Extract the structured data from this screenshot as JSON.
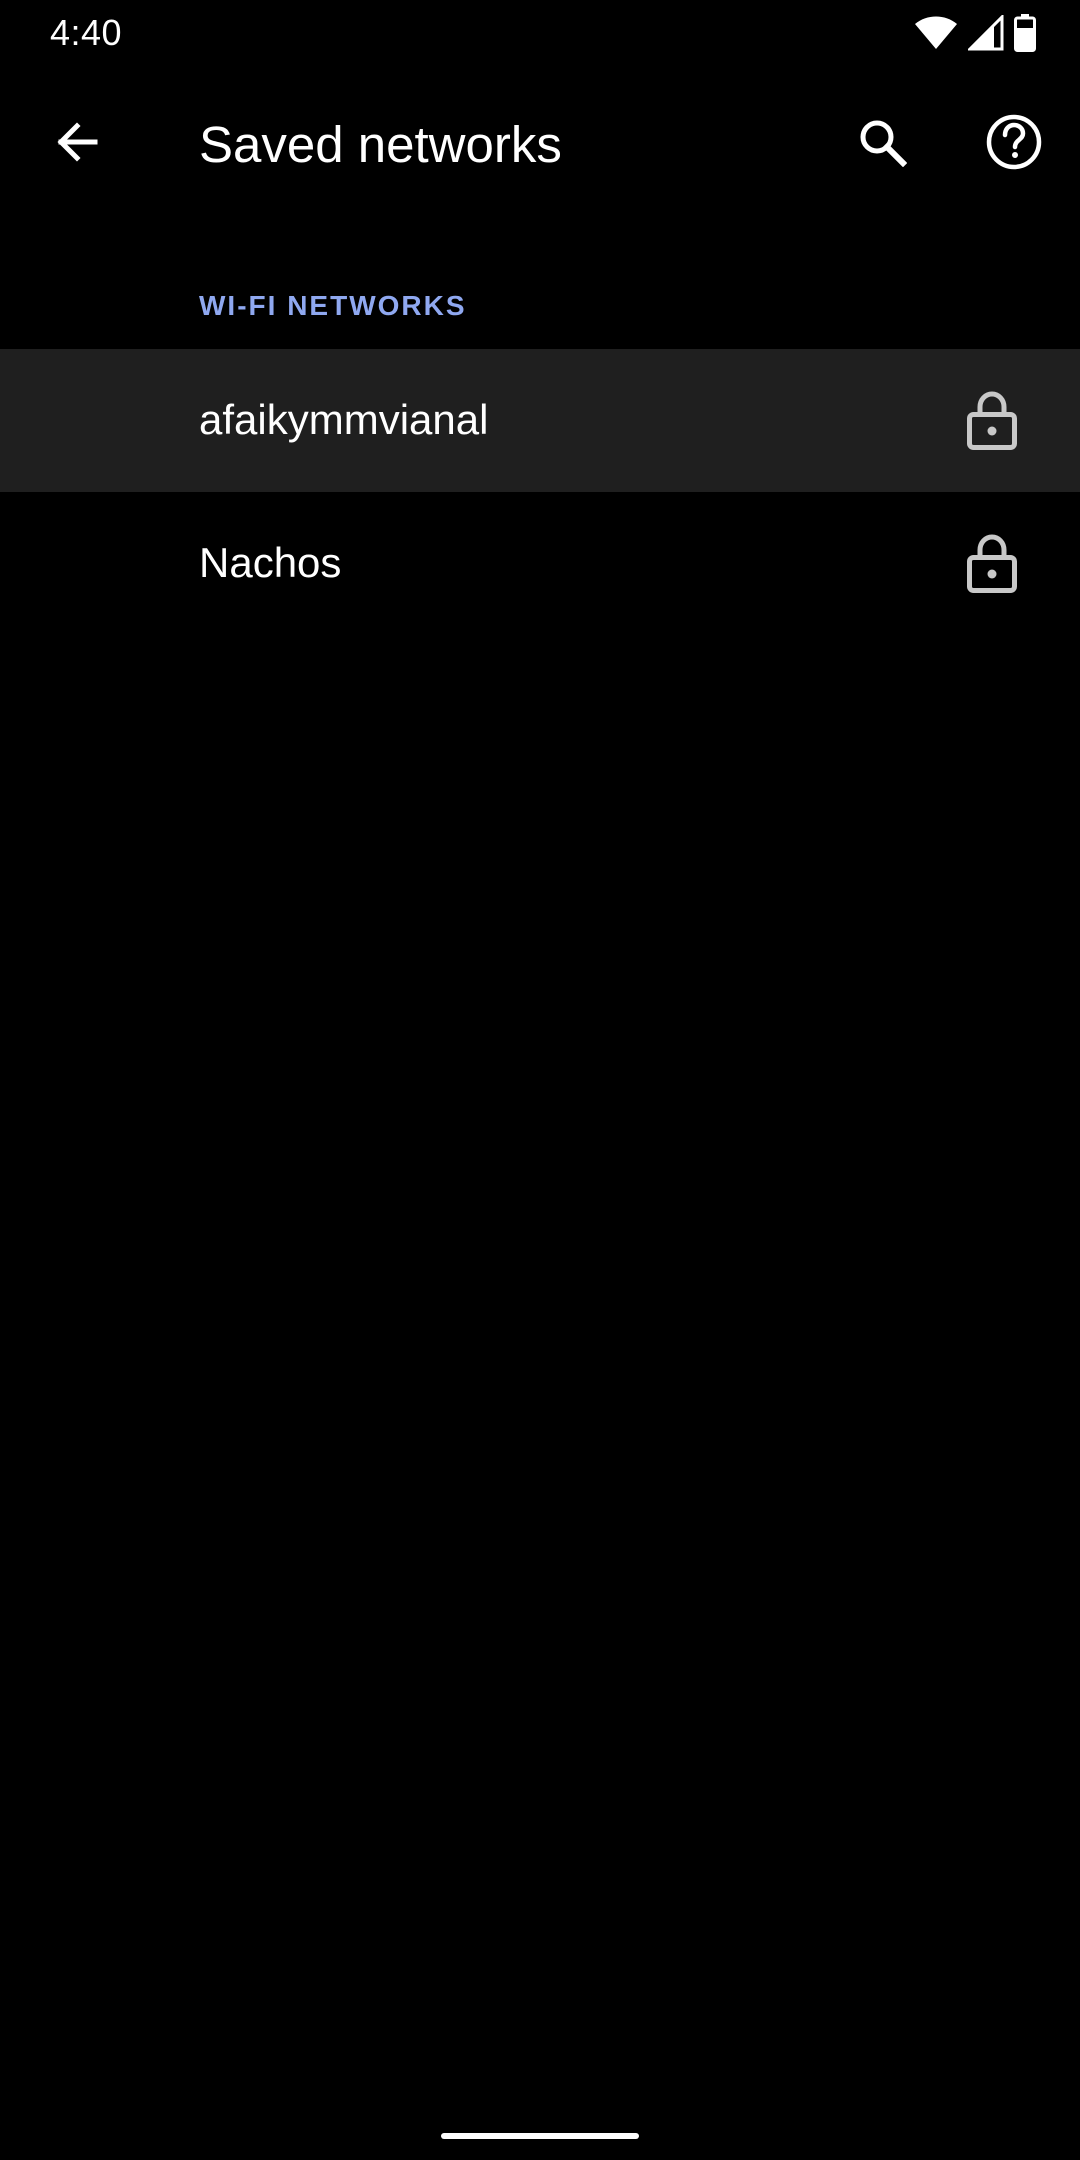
{
  "status_bar": {
    "time": "4:40",
    "icons": [
      "wifi-icon",
      "cellular-signal-icon",
      "battery-icon"
    ]
  },
  "app_bar": {
    "title": "Saved networks",
    "back_icon": "arrow-back-icon",
    "search_icon": "search-icon",
    "help_icon": "help-icon"
  },
  "section": {
    "header": "WI-FI NETWORKS"
  },
  "networks": [
    {
      "name": "afaikymmvianal",
      "icon": "lock-icon",
      "highlighted": true
    },
    {
      "name": "Nachos",
      "icon": "lock-icon",
      "highlighted": false
    }
  ],
  "colors": {
    "background": "#000000",
    "text": "#ffffff",
    "section_header": "#8fa8f0",
    "highlighted_row": "#1f1f1f",
    "lock_icon": "#c8c8c8"
  }
}
